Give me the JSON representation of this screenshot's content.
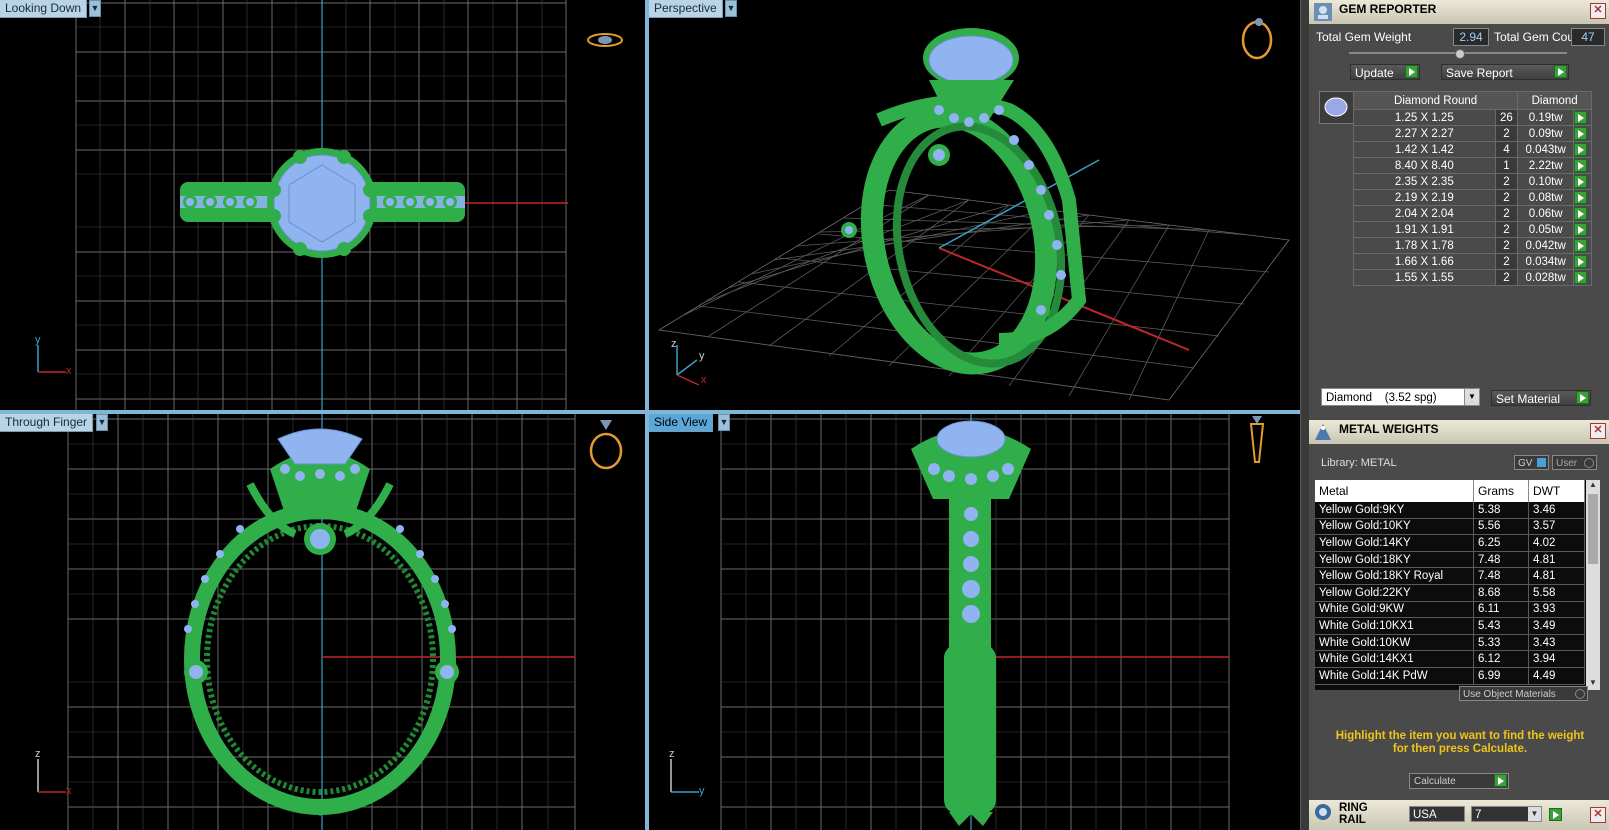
{
  "viewports": {
    "top_left": {
      "label": "Looking Down",
      "axis_a": "y",
      "axis_b": "x"
    },
    "top_right": {
      "label": "Perspective",
      "axis_a": "z",
      "axis_b": "y",
      "axis_c": "x"
    },
    "bottom_left": {
      "label": "Through Finger",
      "axis_a": "z",
      "axis_b": "x"
    },
    "bottom_right": {
      "label": "Side View",
      "axis_a": "z",
      "axis_b": "y"
    }
  },
  "gem_reporter": {
    "title": "GEM REPORTER",
    "total_weight_label": "Total Gem Weight",
    "total_weight": "2.94",
    "total_count_label": "Total Gem Count",
    "total_count": "47",
    "update_label": "Update",
    "save_label": "Save Report",
    "col_shape": "Diamond Round",
    "col_material": "Diamond",
    "rows": [
      {
        "size": "1.25 X 1.25",
        "count": "26",
        "weight": "0.19tw"
      },
      {
        "size": "2.27 X 2.27",
        "count": "2",
        "weight": "0.09tw"
      },
      {
        "size": "1.42 X 1.42",
        "count": "4",
        "weight": "0.043tw"
      },
      {
        "size": "8.40 X 8.40",
        "count": "1",
        "weight": "2.22tw"
      },
      {
        "size": "2.35 X 2.35",
        "count": "2",
        "weight": "0.10tw"
      },
      {
        "size": "2.19 X 2.19",
        "count": "2",
        "weight": "0.08tw"
      },
      {
        "size": "2.04 X 2.04",
        "count": "2",
        "weight": "0.06tw"
      },
      {
        "size": "1.91 X 1.91",
        "count": "2",
        "weight": "0.05tw"
      },
      {
        "size": "1.78 X 1.78",
        "count": "2",
        "weight": "0.042tw"
      },
      {
        "size": "1.66 X 1.66",
        "count": "2",
        "weight": "0.034tw"
      },
      {
        "size": "1.55 X 1.55",
        "count": "2",
        "weight": "0.028tw"
      }
    ],
    "material_select": "Diamond    (3.52 spg)",
    "set_material_label": "Set Material"
  },
  "metal_weights": {
    "title": "METAL WEIGHTS",
    "library_label": "Library: METAL",
    "gv_label": "GV",
    "user_label": "User",
    "col_metal": "Metal",
    "col_grams": "Grams",
    "col_dwt": "DWT",
    "rows": [
      {
        "metal": "Yellow Gold:9KY",
        "grams": "5.38",
        "dwt": "3.46"
      },
      {
        "metal": "Yellow Gold:10KY",
        "grams": "5.56",
        "dwt": "3.57"
      },
      {
        "metal": "Yellow Gold:14KY",
        "grams": "6.25",
        "dwt": "4.02"
      },
      {
        "metal": "Yellow Gold:18KY",
        "grams": "7.48",
        "dwt": "4.81"
      },
      {
        "metal": "Yellow Gold:18KY Royal",
        "grams": "7.48",
        "dwt": "4.81"
      },
      {
        "metal": "Yellow Gold:22KY",
        "grams": "8.68",
        "dwt": "5.58"
      },
      {
        "metal": "White Gold:9KW",
        "grams": "6.11",
        "dwt": "3.93"
      },
      {
        "metal": "White Gold:10KX1",
        "grams": "5.43",
        "dwt": "3.49"
      },
      {
        "metal": "White Gold:10KW",
        "grams": "5.33",
        "dwt": "3.43"
      },
      {
        "metal": "White Gold:14KX1",
        "grams": "6.12",
        "dwt": "3.94"
      },
      {
        "metal": "White Gold:14K PdW",
        "grams": "6.99",
        "dwt": "4.49"
      }
    ],
    "use_object_materials": "Use Object Materials",
    "instruction": "Highlight the item you want to find the weight for then press Calculate.",
    "calculate_label": "Calculate"
  },
  "ring_rail": {
    "title": "RING RAIL",
    "region": "USA",
    "size": "7"
  },
  "colors": {
    "metal": "#2fae4a",
    "gem": "#8fb4f0",
    "accent": "#5aa8d8",
    "highlight": "#f0c419"
  }
}
